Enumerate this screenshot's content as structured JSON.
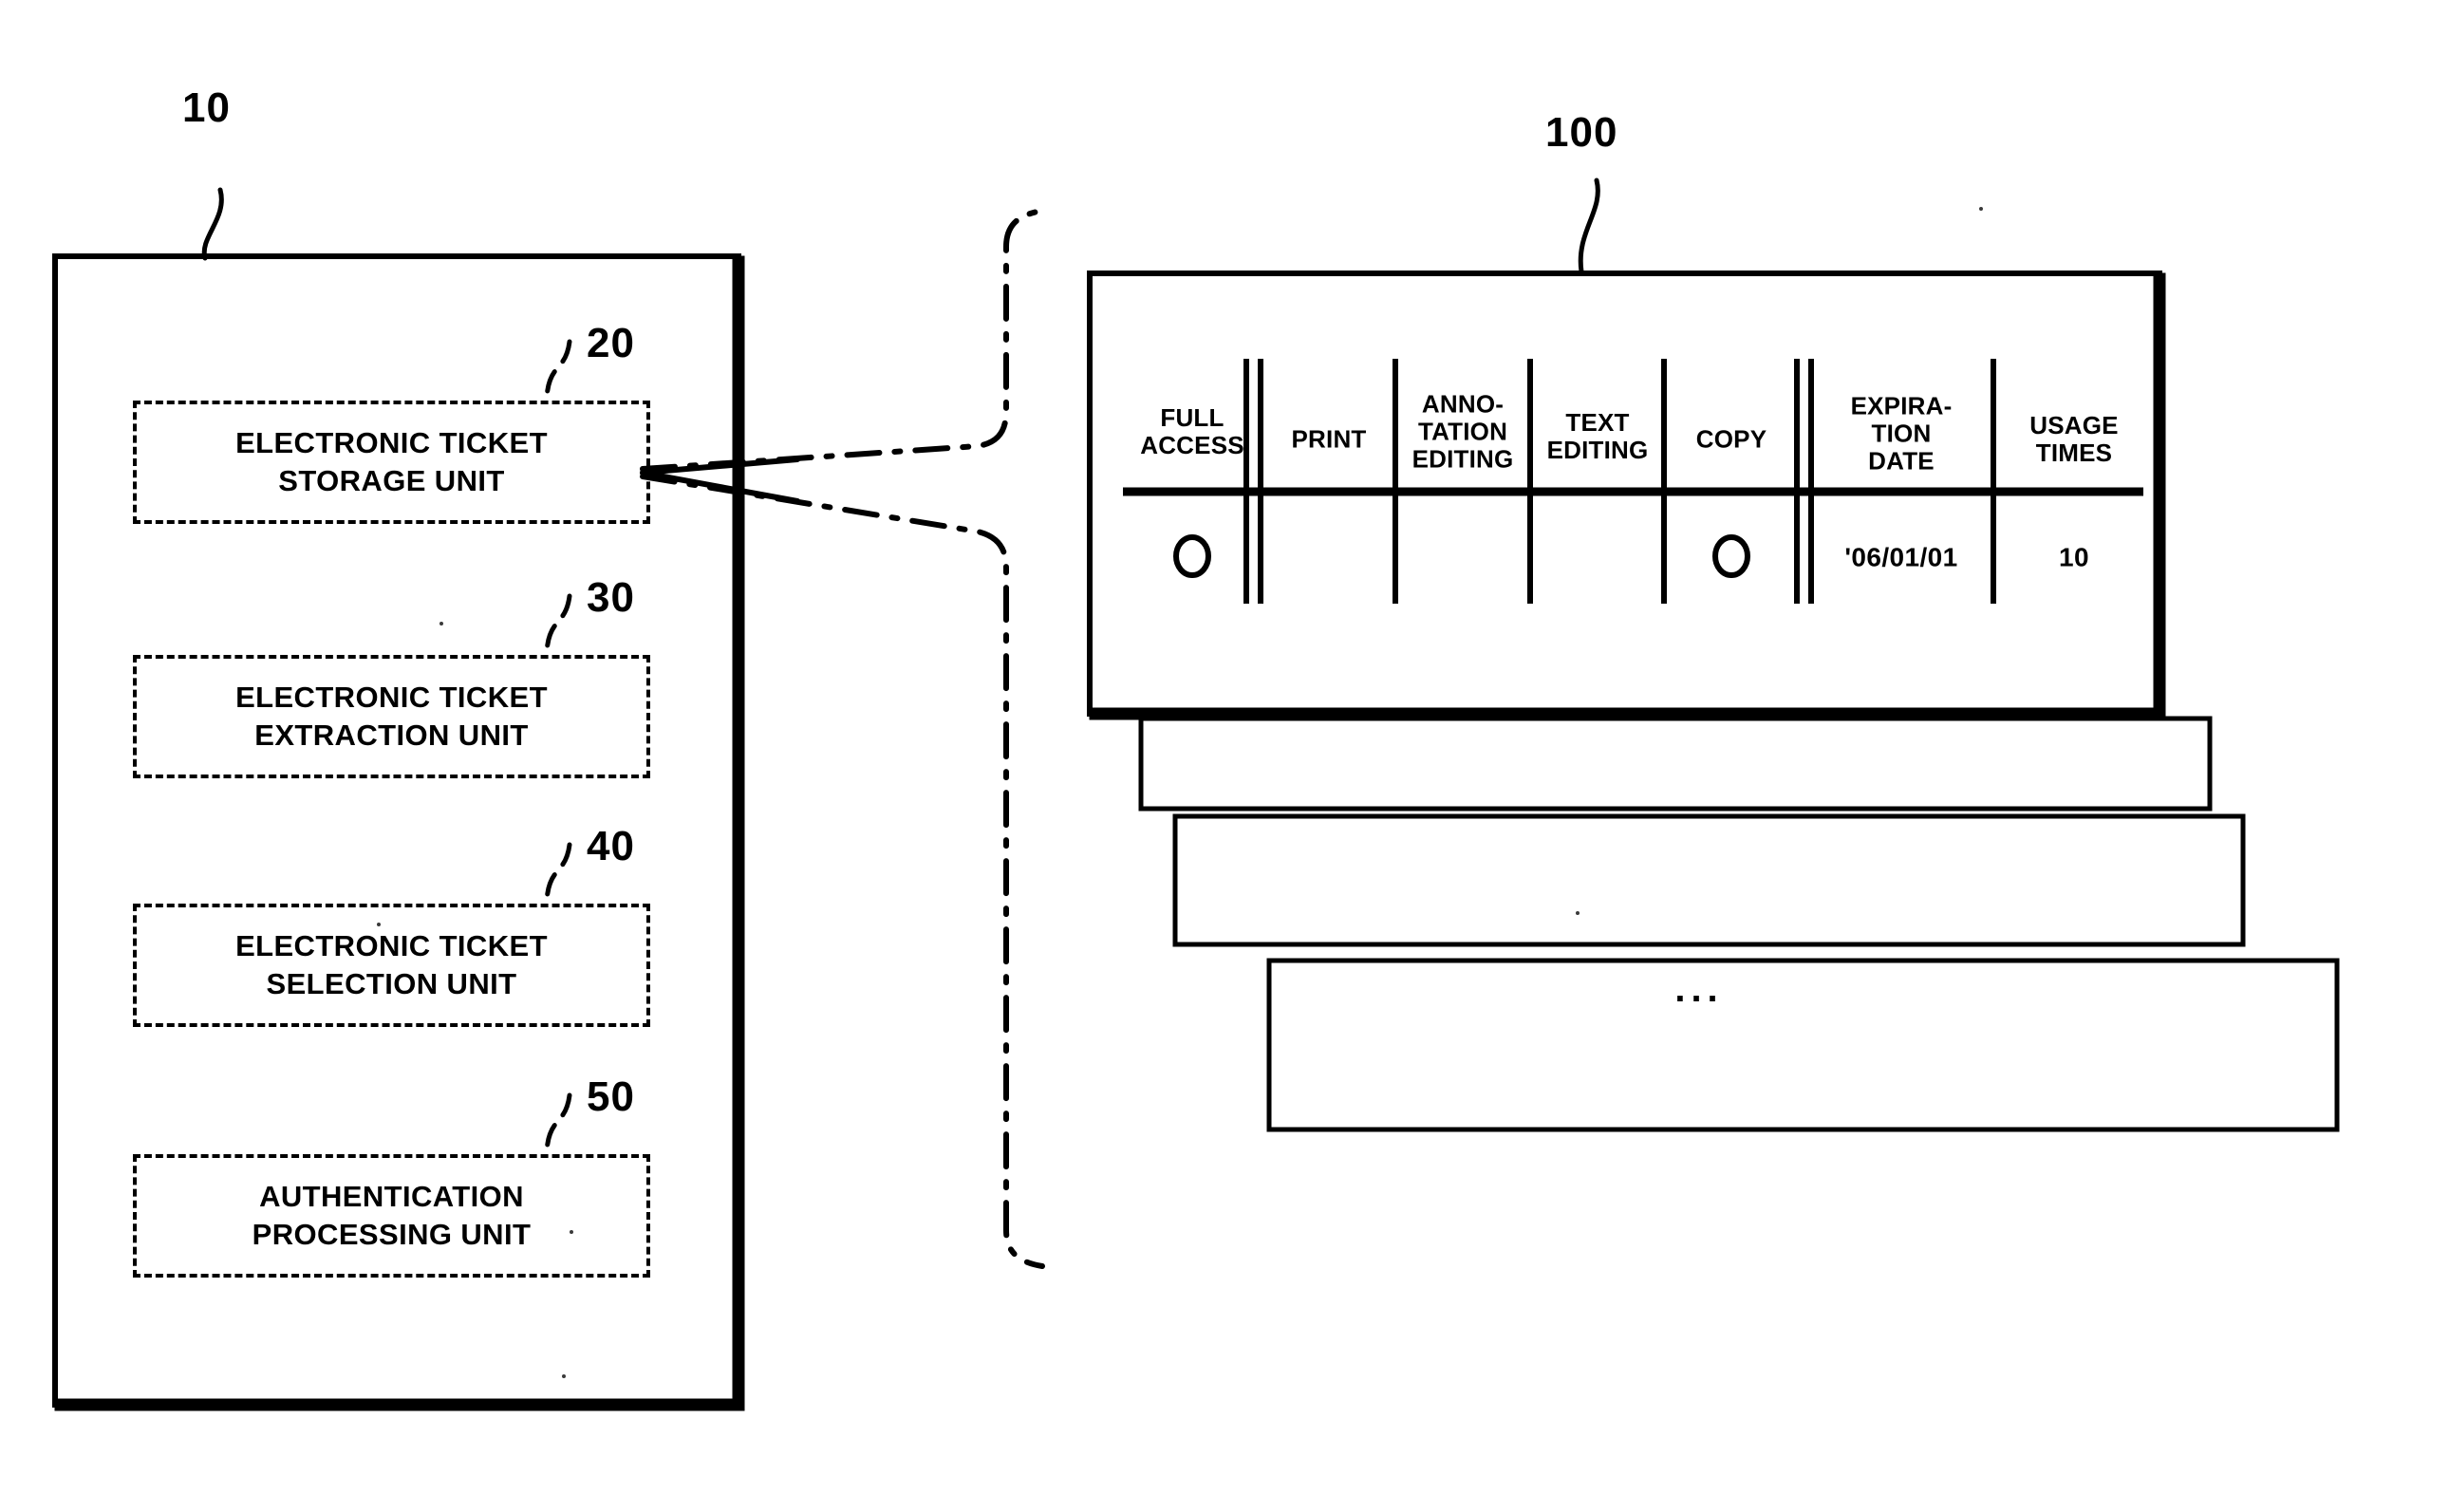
{
  "figure": {
    "type": "patent-block-diagram",
    "background_color": "#ffffff",
    "line_color": "#000000"
  },
  "device": {
    "ref_numeral": "10",
    "units": [
      {
        "ref_numeral": "20",
        "label": "ELECTRONIC TICKET\nSTORAGE UNIT"
      },
      {
        "ref_numeral": "30",
        "label": "ELECTRONIC TICKET\nEXTRACTION UNIT"
      },
      {
        "ref_numeral": "40",
        "label": "ELECTRONIC TICKET\nSELECTION UNIT"
      },
      {
        "ref_numeral": "50",
        "label": "AUTHENTICATION\nPROCESSING UNIT"
      }
    ]
  },
  "ticket_stack": {
    "ref_numeral": "100",
    "more_indicator": "...",
    "card_count": 4,
    "table": {
      "columns": [
        "FULL\nACCESS",
        "PRINT",
        "ANNO-\nTATION\nEDITING",
        "TEXT\nEDITING",
        "COPY",
        "EXPIRA-\nTION\nDATE",
        "USAGE\nTIMES"
      ],
      "rows": [
        {
          "FULL ACCESS": "○",
          "PRINT": "",
          "ANNOTATION EDITING": "",
          "TEXT EDITING": "",
          "COPY": "○",
          "EXPIRATION DATE": "'06/01/01",
          "USAGE TIMES": "10"
        }
      ]
    }
  }
}
